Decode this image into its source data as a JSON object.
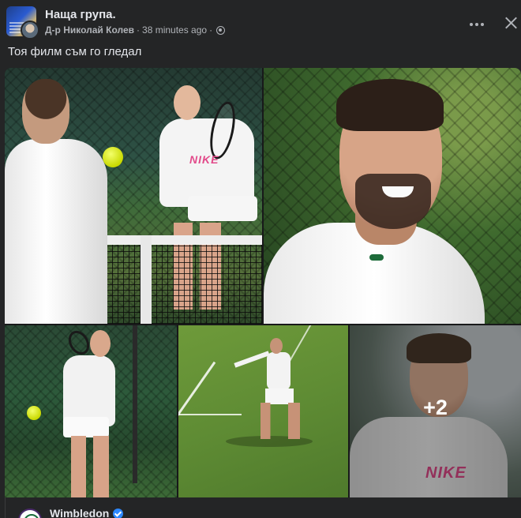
{
  "post": {
    "group_name": "Наща група.",
    "author": "Д-р Николай Колев",
    "separator": "·",
    "time": "38 minutes ago",
    "text": "Тоя филм съм го гледал"
  },
  "gallery": {
    "photos": [
      {
        "shirt_logo": "NIKE"
      },
      {},
      {},
      {},
      {
        "shirt_logo": "NIKE",
        "more_count": "+2"
      }
    ]
  },
  "shared": {
    "name": "Wimbledon"
  },
  "colors": {
    "background": "#242526",
    "text_primary": "#e4e6eb",
    "text_secondary": "#b0b3b8",
    "verified": "#2d88ff"
  }
}
